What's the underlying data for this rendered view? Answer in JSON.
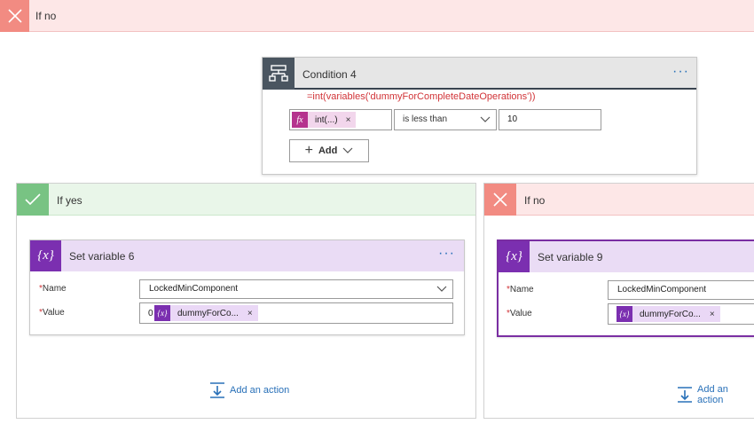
{
  "top_branch": {
    "label": "If no"
  },
  "condition": {
    "title": "Condition 4",
    "more": "···",
    "expression": "=int(variables('dummyForCompleteDateOperations'))",
    "left_token": {
      "icon": "fx",
      "label": "int(...)",
      "remove": "×"
    },
    "operator": "is less than",
    "value": "10",
    "add_label": "Add"
  },
  "yes_branch": {
    "label": "If yes",
    "card": {
      "title": "Set variable 6",
      "more": "···",
      "name_label": "Name",
      "name_value": "LockedMinComponent",
      "value_label": "Value",
      "value_prefix": "0",
      "value_token": {
        "label": "dummyForCo...",
        "remove": "×"
      },
      "icon_text": "{x}"
    },
    "add_action": "Add an action"
  },
  "no_branch": {
    "label": "If no",
    "card": {
      "title": "Set variable 9",
      "name_label": "Name",
      "name_value": "LockedMinComponent",
      "value_label": "Value",
      "value_token": {
        "label": "dummyForCo...",
        "remove": "×"
      },
      "icon_text": "{x}"
    },
    "add_action": "Add an action"
  },
  "required_mark": "*",
  "colors": {
    "no_accent": "#f28b82",
    "yes_accent": "#78c383",
    "variable_purple": "#7b2fb0",
    "expression_fx": "#b5338e",
    "link_blue": "#2870b8",
    "error_red": "#d13438"
  }
}
